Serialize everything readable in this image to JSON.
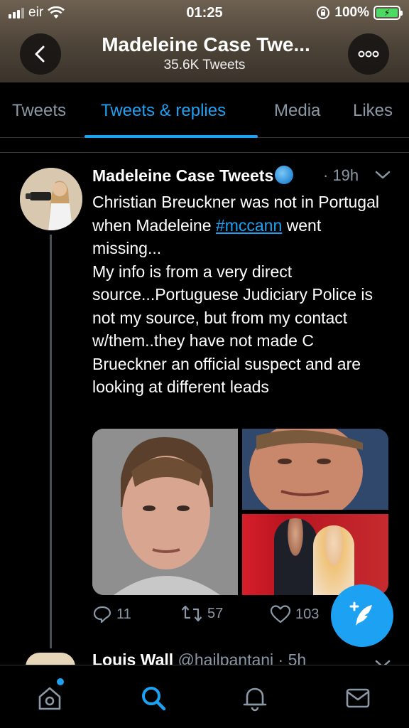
{
  "status_bar": {
    "carrier": "eir",
    "time": "01:25",
    "battery": "100%"
  },
  "header": {
    "title": "Madeleine Case Twe...",
    "subtitle": "35.6K Tweets"
  },
  "tabs": [
    {
      "label": "Tweets",
      "active": false
    },
    {
      "label": "Tweets & replies",
      "active": true
    },
    {
      "label": "Media",
      "active": false
    },
    {
      "label": "Likes",
      "active": false
    }
  ],
  "tweet": {
    "author": "Madeleine Case Tweets",
    "time": "· 19h",
    "text_before": "Christian Breuckner was not in Portugal when Madeleine ",
    "hashtag": "#mccann",
    "text_after": " went missing...\nMy info is from a very direct source...Portuguese Judiciary Police is not my source, but from my contact w/them..they have not made C Brueckner an official suspect and are looking at different leads",
    "replies": "11",
    "retweets": "57",
    "likes": "103"
  },
  "next_tweet": {
    "author": "Louis Wall",
    "handle": "@hailpantani",
    "time": "· 5h"
  },
  "colors": {
    "accent": "#1da1f2",
    "muted": "#8b98a5",
    "background": "#000000"
  }
}
